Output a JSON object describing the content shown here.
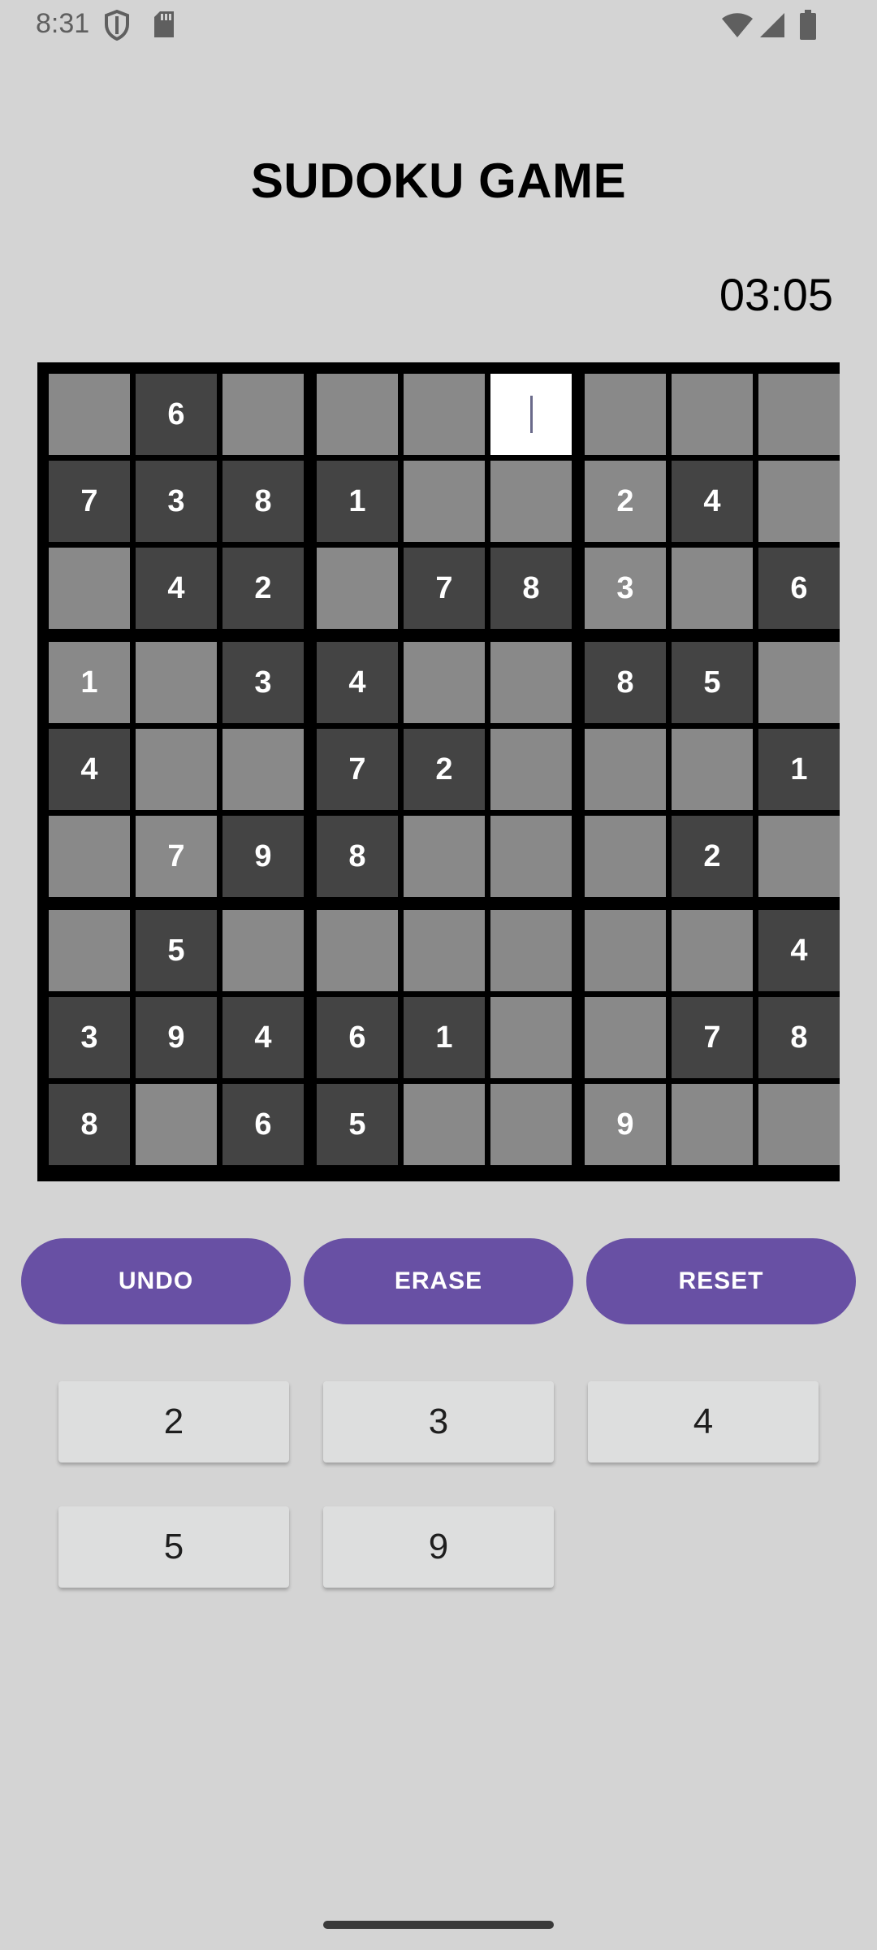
{
  "status": {
    "time": "8:31",
    "icons": [
      "shield-icon",
      "sd-card-icon",
      "wifi-icon",
      "cellular-signal-icon",
      "battery-icon"
    ]
  },
  "title": "SUDOKU GAME",
  "timer": "03:05",
  "board": {
    "rows": [
      [
        "",
        "6",
        "",
        "",
        "",
        "",
        "",
        "",
        ""
      ],
      [
        "7",
        "3",
        "8",
        "1",
        "",
        "",
        "2",
        "4",
        ""
      ],
      [
        "",
        "4",
        "2",
        "",
        "7",
        "8",
        "3",
        "",
        "6"
      ],
      [
        "1",
        "",
        "3",
        "4",
        "",
        "",
        "8",
        "5",
        ""
      ],
      [
        "4",
        "",
        "",
        "7",
        "2",
        "",
        "",
        "",
        "1"
      ],
      [
        "",
        "7",
        "9",
        "8",
        "",
        "",
        "",
        "2",
        ""
      ],
      [
        "",
        "5",
        "",
        "",
        "",
        "",
        "",
        "",
        "4"
      ],
      [
        "3",
        "9",
        "4",
        "6",
        "1",
        "",
        "",
        "7",
        "8"
      ],
      [
        "8",
        "",
        "6",
        "5",
        "",
        "",
        "9",
        "",
        ""
      ]
    ],
    "light_filled": [
      [
        1,
        6
      ],
      [
        2,
        6
      ],
      [
        3,
        0
      ],
      [
        5,
        1
      ],
      [
        8,
        6
      ]
    ],
    "selected": [
      0,
      5
    ],
    "colors": {
      "fixed": "#444444",
      "empty": "#898989",
      "selected": "#ffffff",
      "border": "#000000"
    }
  },
  "actions": {
    "undo": "UNDO",
    "erase": "ERASE",
    "reset": "RESET",
    "color": "#6850a4"
  },
  "number_pad": [
    "2",
    "3",
    "4",
    "5",
    "9"
  ]
}
